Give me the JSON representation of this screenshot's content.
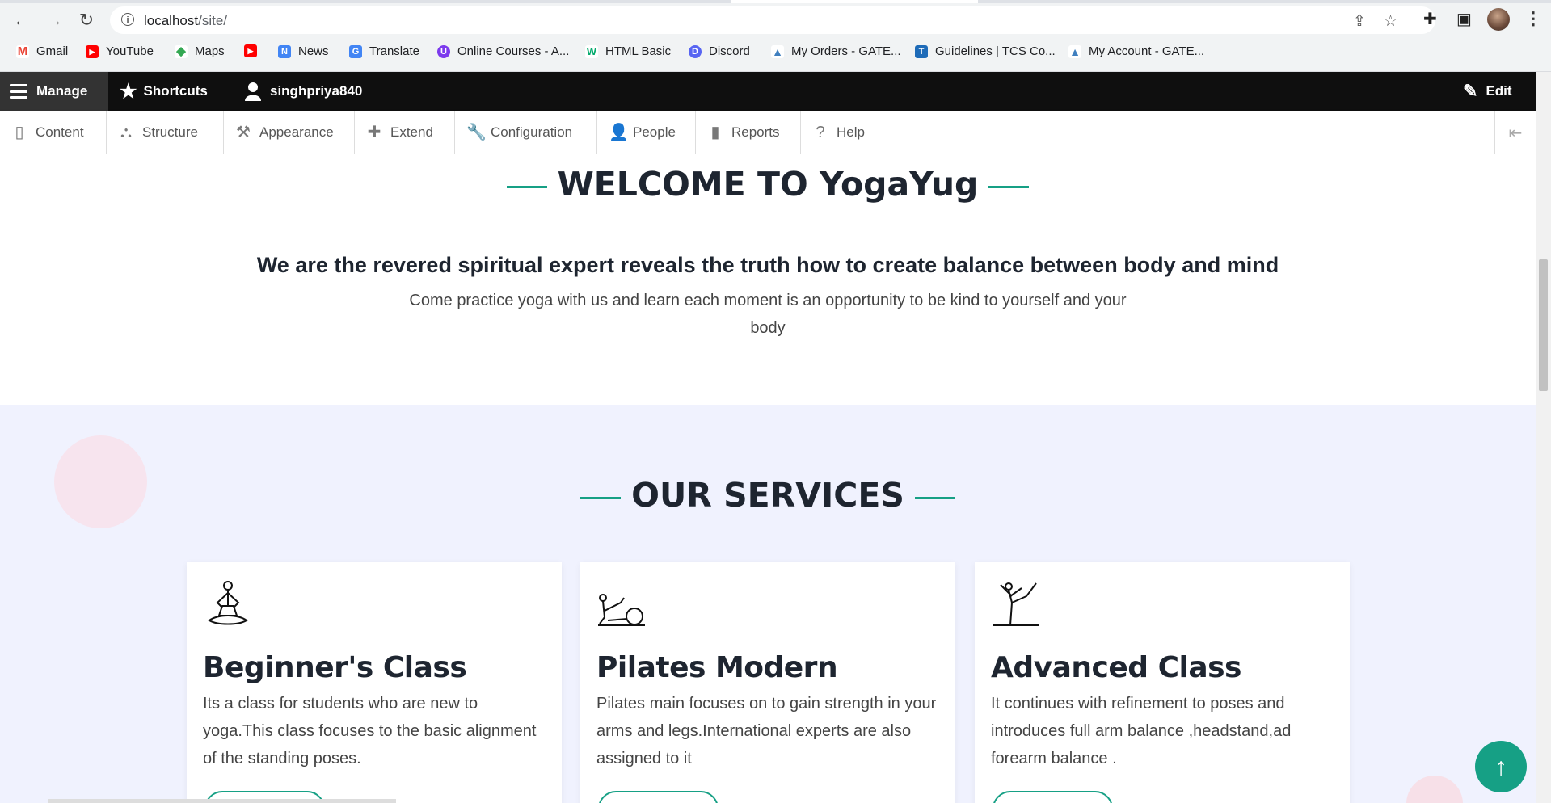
{
  "browser": {
    "url_host": "localhost",
    "url_path": "/site/",
    "bookmarks": [
      {
        "label": "Gmail",
        "color": "#ea4335",
        "glyph": "M"
      },
      {
        "label": "YouTube",
        "color": "#ff0000",
        "glyph": "▶"
      },
      {
        "label": "Maps",
        "color": "#34a853",
        "glyph": "◆"
      },
      {
        "label": "",
        "color": "#ff0000",
        "glyph": "▶"
      },
      {
        "label": "News",
        "color": "#4285f4",
        "glyph": "N"
      },
      {
        "label": "Translate",
        "color": "#4285f4",
        "glyph": "G"
      },
      {
        "label": "Online Courses - A...",
        "color": "#7c3aed",
        "glyph": "U"
      },
      {
        "label": "HTML Basic",
        "color": "#04aa6d",
        "glyph": "w"
      },
      {
        "label": "Discord",
        "color": "#5865f2",
        "glyph": "D"
      },
      {
        "label": "My Orders - GATE...",
        "color": "#3f7fbf",
        "glyph": "▲"
      },
      {
        "label": "Guidelines | TCS Co...",
        "color": "#1e6bb8",
        "glyph": "T"
      },
      {
        "label": "My Account - GATE...",
        "color": "#3f7fbf",
        "glyph": "▲"
      }
    ]
  },
  "admin_bar": {
    "manage": "Manage",
    "shortcuts": "Shortcuts",
    "user": "singhpriya840",
    "edit": "Edit"
  },
  "tray": [
    {
      "label": "Content",
      "icon": "page-icon"
    },
    {
      "label": "Structure",
      "icon": "sitemap-icon"
    },
    {
      "label": "Appearance",
      "icon": "brush-icon"
    },
    {
      "label": "Extend",
      "icon": "puzzle-icon"
    },
    {
      "label": "Configuration",
      "icon": "wrench-icon"
    },
    {
      "label": "People",
      "icon": "person-icon"
    },
    {
      "label": "Reports",
      "icon": "bar-chart-icon"
    },
    {
      "label": "Help",
      "icon": "question-icon"
    }
  ],
  "welcome": {
    "title": "WELCOME TO YogaYug",
    "lead": "We are the revered spiritual expert reveals the truth how to create balance between body and mind",
    "sub": "Come practice yoga with us and learn each moment is an opportunity to be kind to yourself and your body"
  },
  "services": {
    "title": "OUR SERVICES",
    "cards": [
      {
        "title": "Beginner's Class",
        "desc": "Its a class for students who are new to yoga.This class focuses to the basic alignment of the standing poses.",
        "icon": "lotus-pose-icon"
      },
      {
        "title": "Pilates Modern",
        "desc": "Pilates main focuses on to gain strength in your arms and legs.International experts are also assigned to it",
        "icon": "pilates-ball-icon"
      },
      {
        "title": "Advanced Class",
        "desc": "It continues with refinement to poses and introduces full arm balance ,headstand,ad forearm balance .",
        "icon": "dancer-pose-icon"
      }
    ]
  },
  "colors": {
    "accent": "#16a085",
    "section_bg": "#f0f2fe"
  }
}
